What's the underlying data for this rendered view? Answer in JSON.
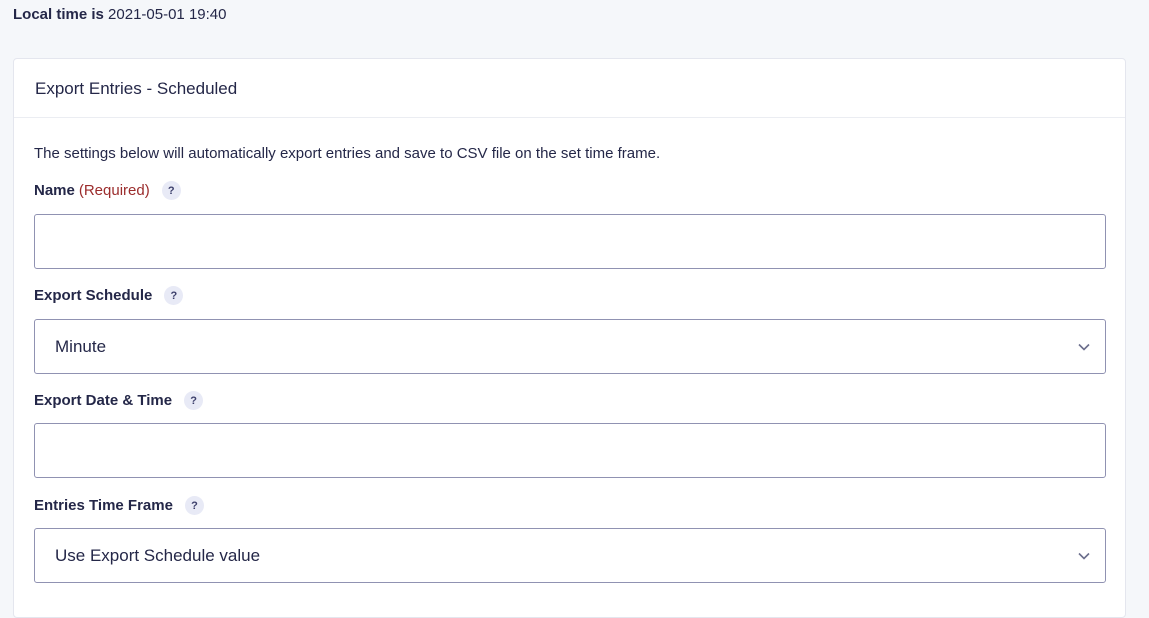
{
  "local_time": {
    "label": "Local time is",
    "value": "2021-05-01 19:40"
  },
  "panel": {
    "title": "Export Entries - Scheduled",
    "description": "The settings below will automatically export entries and save to CSV file on the set time frame."
  },
  "fields": {
    "name": {
      "label": "Name",
      "required": "(Required)",
      "help": "?",
      "value": ""
    },
    "export_schedule": {
      "label": "Export Schedule",
      "help": "?",
      "selected": "Minute"
    },
    "export_date_time": {
      "label": "Export Date & Time",
      "help": "?",
      "value": ""
    },
    "entries_time_frame": {
      "label": "Entries Time Frame",
      "help": "?",
      "selected": "Use Export Schedule value"
    }
  },
  "icons": {
    "help": "question-mark-icon",
    "select_arrow": "chevron-down-icon"
  },
  "colors": {
    "text": "#242748",
    "required": "#9b2c2c",
    "border": "#9092b2",
    "background": "#f5f7fa",
    "help_badge": "#e8eaf6"
  }
}
